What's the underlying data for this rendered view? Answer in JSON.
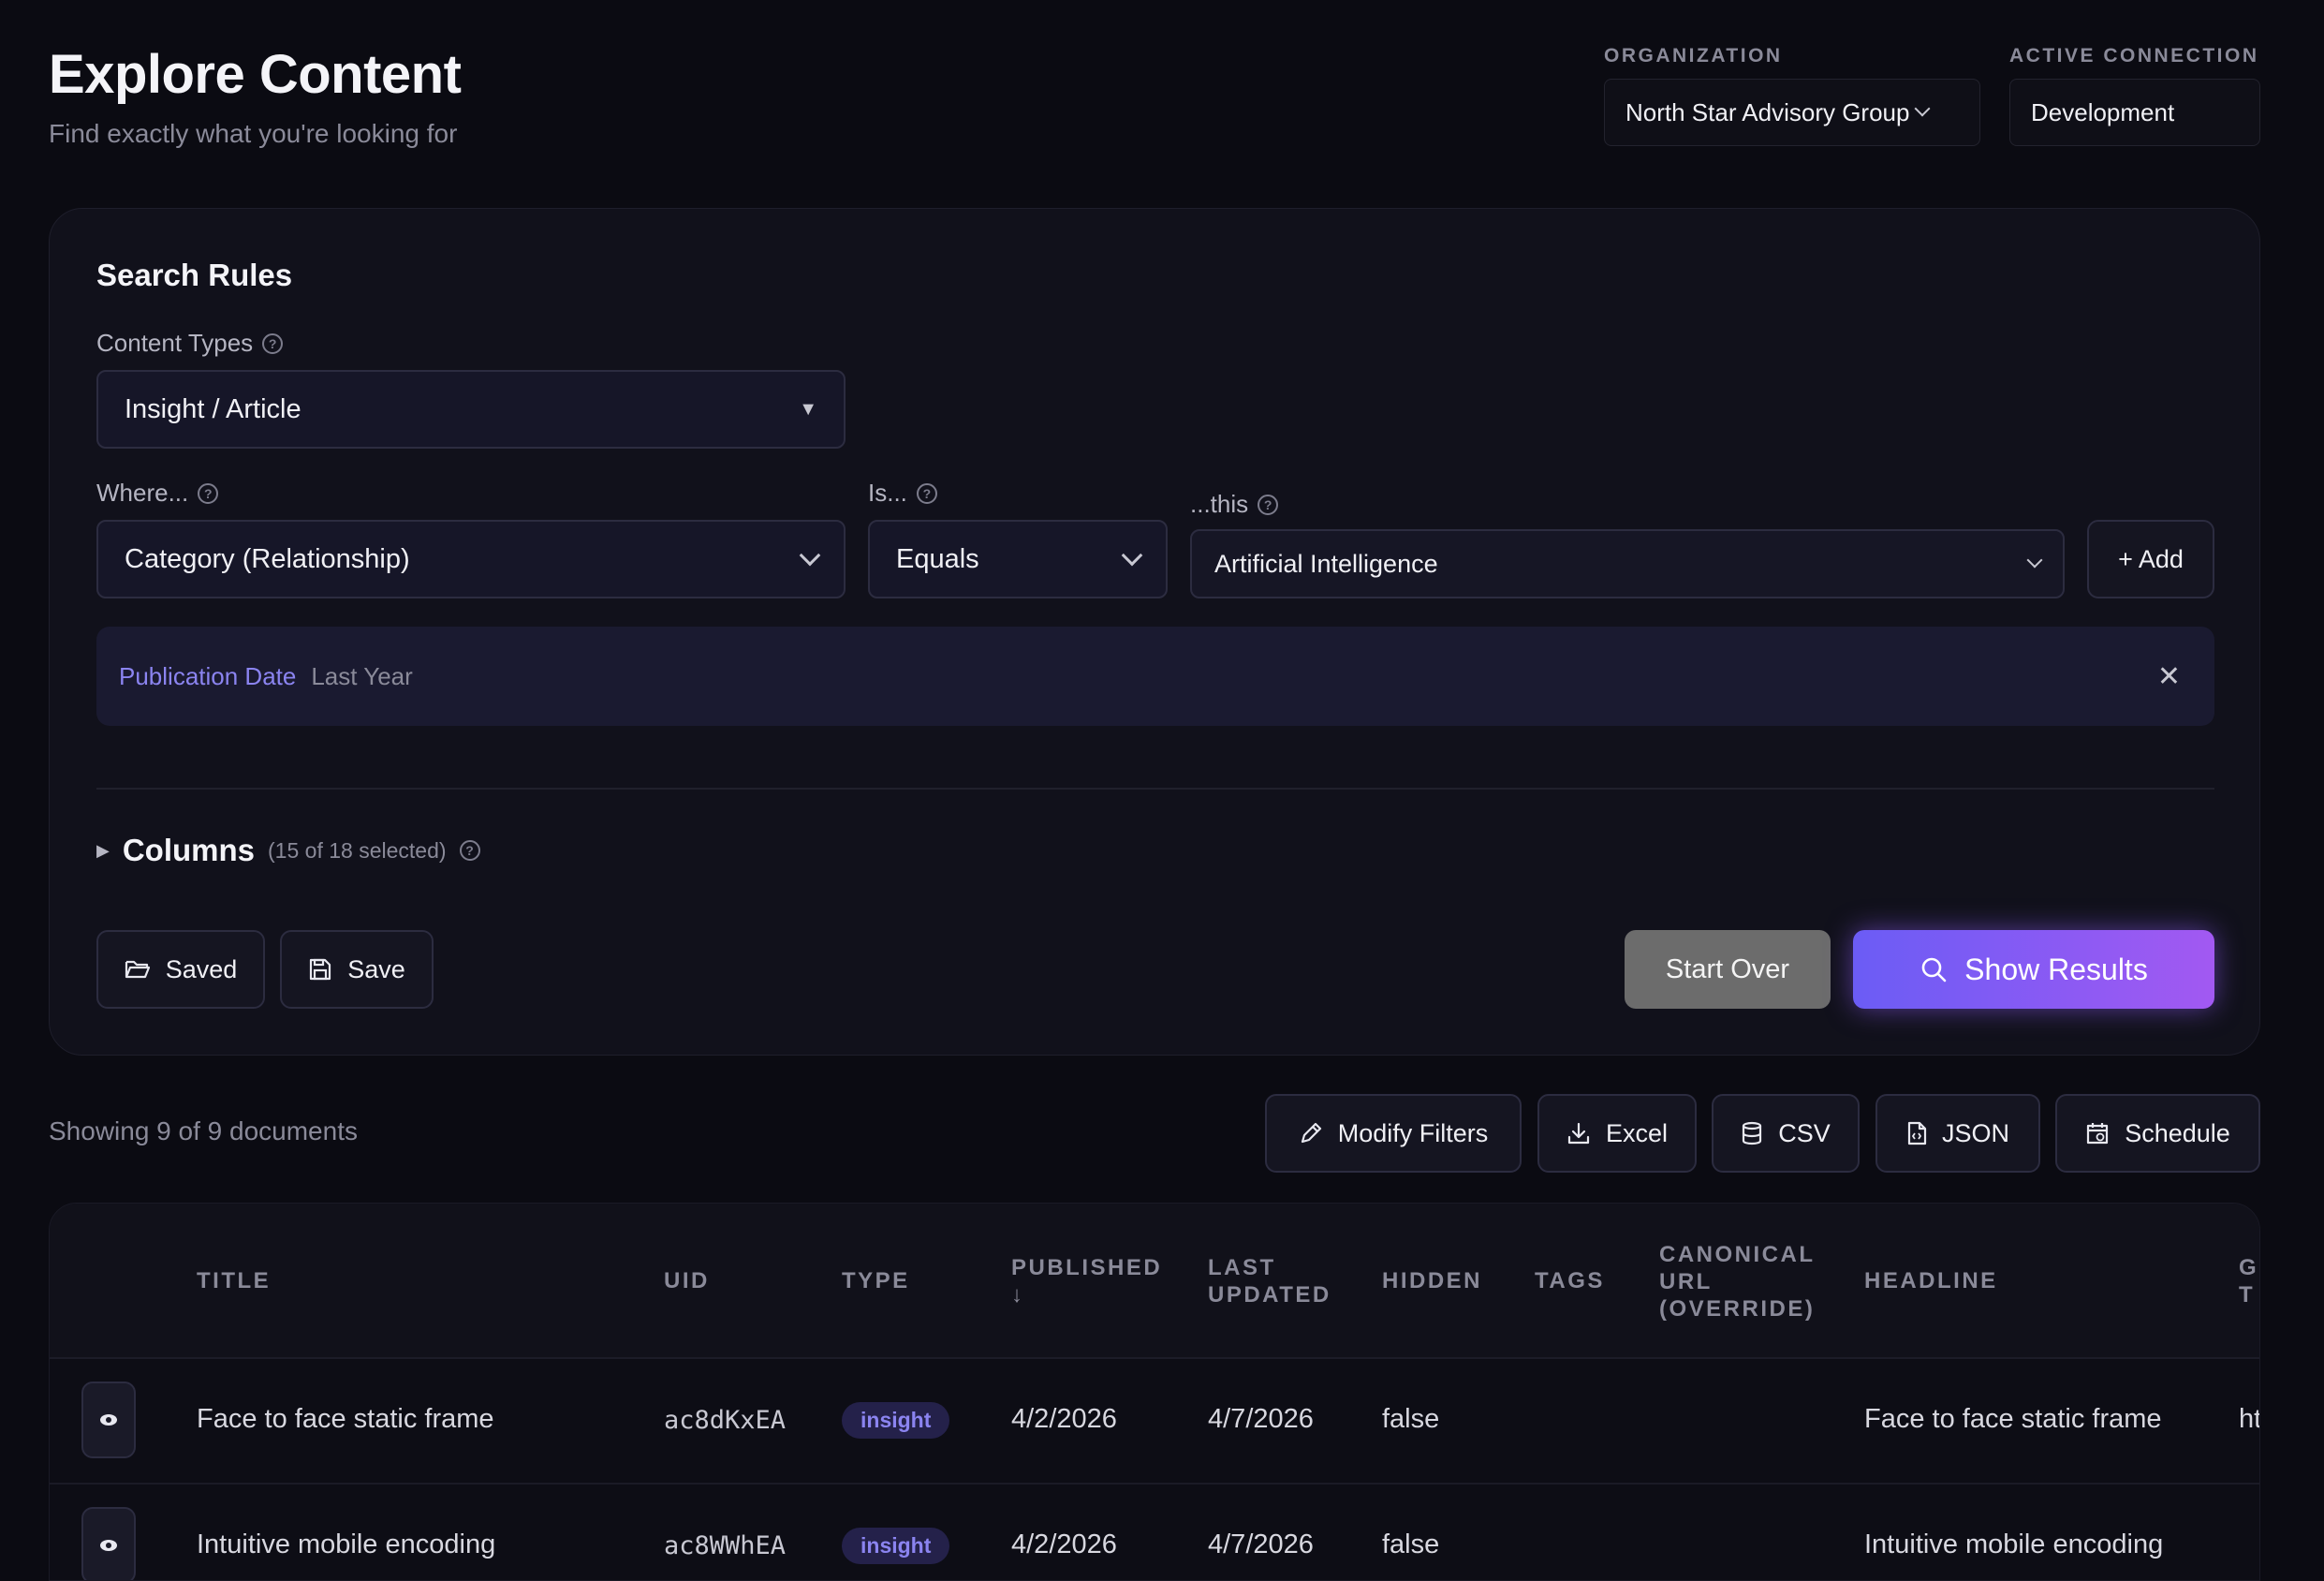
{
  "header": {
    "title": "Explore Content",
    "subtitle": "Find exactly what you're looking for"
  },
  "organization": {
    "label": "ORGANIZATION",
    "value": "North Star Advisory Group"
  },
  "connection": {
    "label": "ACTIVE CONNECTION",
    "value": "Development"
  },
  "search_rules": {
    "title": "Search Rules",
    "content_types_label": "Content Types",
    "content_types_value": "Insight / Article",
    "where_label": "Where...",
    "where_value": "Category (Relationship)",
    "is_label": "Is...",
    "is_value": "Equals",
    "this_label": "...this",
    "this_value": "Artificial Intelligence",
    "add_label": "+ Add",
    "filter_chip": {
      "field": "Publication Date",
      "value": "Last Year"
    },
    "columns_title": "Columns",
    "columns_count": "(15 of 18 selected)",
    "saved_label": "Saved",
    "save_label": "Save",
    "start_over_label": "Start Over",
    "show_results_label": "Show Results"
  },
  "results": {
    "showing_text": "Showing 9 of 9 documents",
    "actions": {
      "modify": "Modify Filters",
      "excel": "Excel",
      "csv": "CSV",
      "json": "JSON",
      "schedule": "Schedule"
    },
    "columns": {
      "title": "TITLE",
      "uid": "UID",
      "type": "TYPE",
      "published": "PUBLISHED",
      "published_sort": "↓",
      "last_updated_1": "LAST",
      "last_updated_2": "UPDATED",
      "hidden": "HIDDEN",
      "tags": "TAGS",
      "canonical_1": "CANONICAL",
      "canonical_2": "URL",
      "canonical_3": "(OVERRIDE)",
      "headline": "HEADLINE",
      "partial_1": "G",
      "partial_2": "T"
    },
    "rows": [
      {
        "title": "Face to face static frame",
        "uid": "ac8dKxEA",
        "type": "insight",
        "published": "4/2/2026",
        "last_updated": "4/7/2026",
        "hidden": "false",
        "headline": "Face to face static frame",
        "partial": "ht"
      },
      {
        "title": "Intuitive mobile encoding",
        "uid": "ac8WWhEA",
        "type": "insight",
        "published": "4/2/2026",
        "last_updated": "4/7/2026",
        "hidden": "false",
        "headline": "Intuitive mobile encoding",
        "partial": ""
      }
    ]
  }
}
